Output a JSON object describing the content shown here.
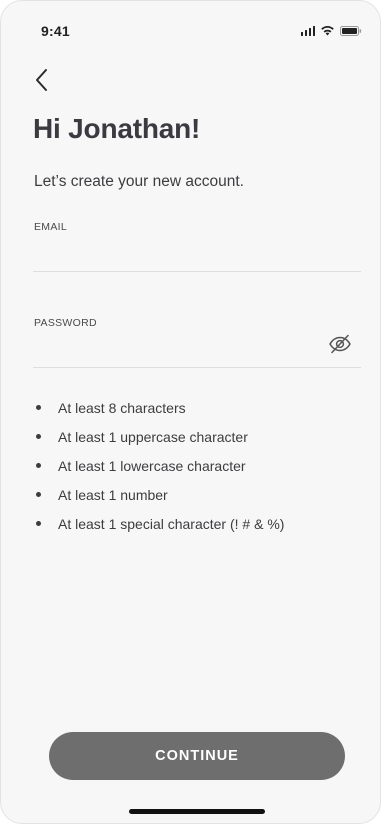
{
  "status_bar": {
    "time": "9:41"
  },
  "header": {
    "back_icon": "chevron-left-icon"
  },
  "title": "Hi Jonathan!",
  "subtitle": "Let’s create your new account.",
  "form": {
    "email": {
      "label": "EMAIL",
      "value": "",
      "placeholder": ""
    },
    "password": {
      "label": "PASSWORD",
      "value": "",
      "placeholder": "",
      "toggle_icon": "eye-slash-icon"
    }
  },
  "requirements": [
    "At least 8 characters",
    "At least 1 uppercase character",
    "At least 1 lowercase character",
    "At least 1 number",
    "At least 1 special character (! # & %)"
  ],
  "continue_button": {
    "label": "CONTINUE"
  },
  "colors": {
    "background": "#f7f7f7",
    "title_text": "#3a3a40",
    "button_background": "#6e6e6e",
    "button_text": "#ffffff",
    "divider": "#dedede"
  }
}
